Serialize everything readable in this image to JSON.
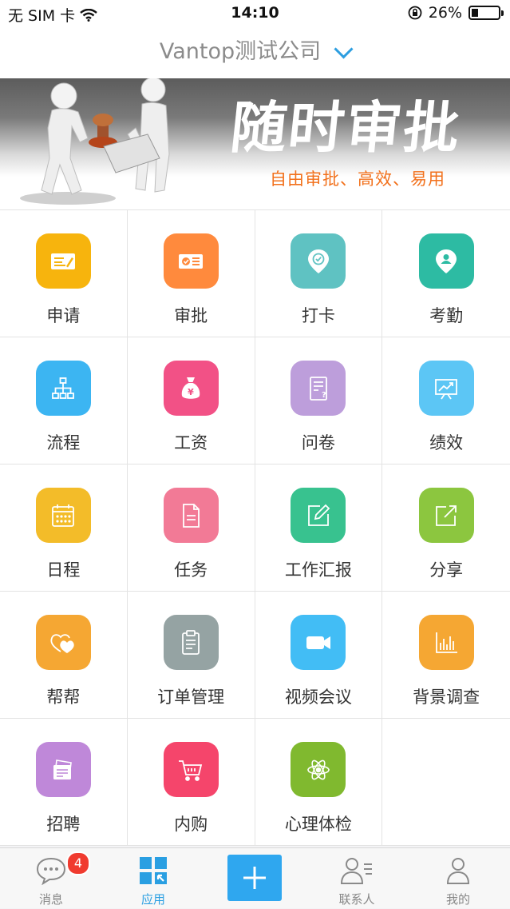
{
  "status_bar": {
    "carrier": "无 SIM 卡",
    "time": "14:10",
    "battery": "26%",
    "battery_level": 0.26
  },
  "header": {
    "company": "Vantop测试公司"
  },
  "banner": {
    "title": "随时审批",
    "subtitle": "自由审批、高效、易用"
  },
  "apps": [
    {
      "label": "申请",
      "color": "#f7b40d",
      "icon": "form-pen-icon"
    },
    {
      "label": "审批",
      "color": "#ff8a3d",
      "icon": "approve-card-icon"
    },
    {
      "label": "打卡",
      "color": "#5fc2c2",
      "icon": "location-check-icon"
    },
    {
      "label": "考勤",
      "color": "#2dbba3",
      "icon": "location-person-icon"
    },
    {
      "label": "流程",
      "color": "#3cb5f2",
      "icon": "flow-chart-icon"
    },
    {
      "label": "工资",
      "color": "#f25186",
      "icon": "money-bag-icon"
    },
    {
      "label": "问卷",
      "color": "#bd9edb",
      "icon": "questionnaire-icon"
    },
    {
      "label": "绩效",
      "color": "#5cc6f5",
      "icon": "presentation-chart-icon"
    },
    {
      "label": "日程",
      "color": "#f3bc29",
      "icon": "calendar-icon"
    },
    {
      "label": "任务",
      "color": "#f27a96",
      "icon": "document-icon"
    },
    {
      "label": "工作汇报",
      "color": "#38c28f",
      "icon": "edit-report-icon"
    },
    {
      "label": "分享",
      "color": "#8cc63f",
      "icon": "share-icon"
    },
    {
      "label": "帮帮",
      "color": "#f5a733",
      "icon": "hearts-icon"
    },
    {
      "label": "订单管理",
      "color": "#95a3a3",
      "icon": "clipboard-icon"
    },
    {
      "label": "视频会议",
      "color": "#42bdf5",
      "icon": "video-camera-icon"
    },
    {
      "label": "背景调查",
      "color": "#f5a733",
      "icon": "bar-chart-icon"
    },
    {
      "label": "招聘",
      "color": "#bf88d9",
      "icon": "recruit-cards-icon"
    },
    {
      "label": "内购",
      "color": "#f5456b",
      "icon": "shopping-cart-icon"
    },
    {
      "label": "心理体检",
      "color": "#80b92f",
      "icon": "atom-icon"
    }
  ],
  "tabbar": {
    "messages": {
      "label": "消息",
      "badge": "4"
    },
    "apps": {
      "label": "应用"
    },
    "contacts": {
      "label": "联系人"
    },
    "me": {
      "label": "我的"
    }
  }
}
